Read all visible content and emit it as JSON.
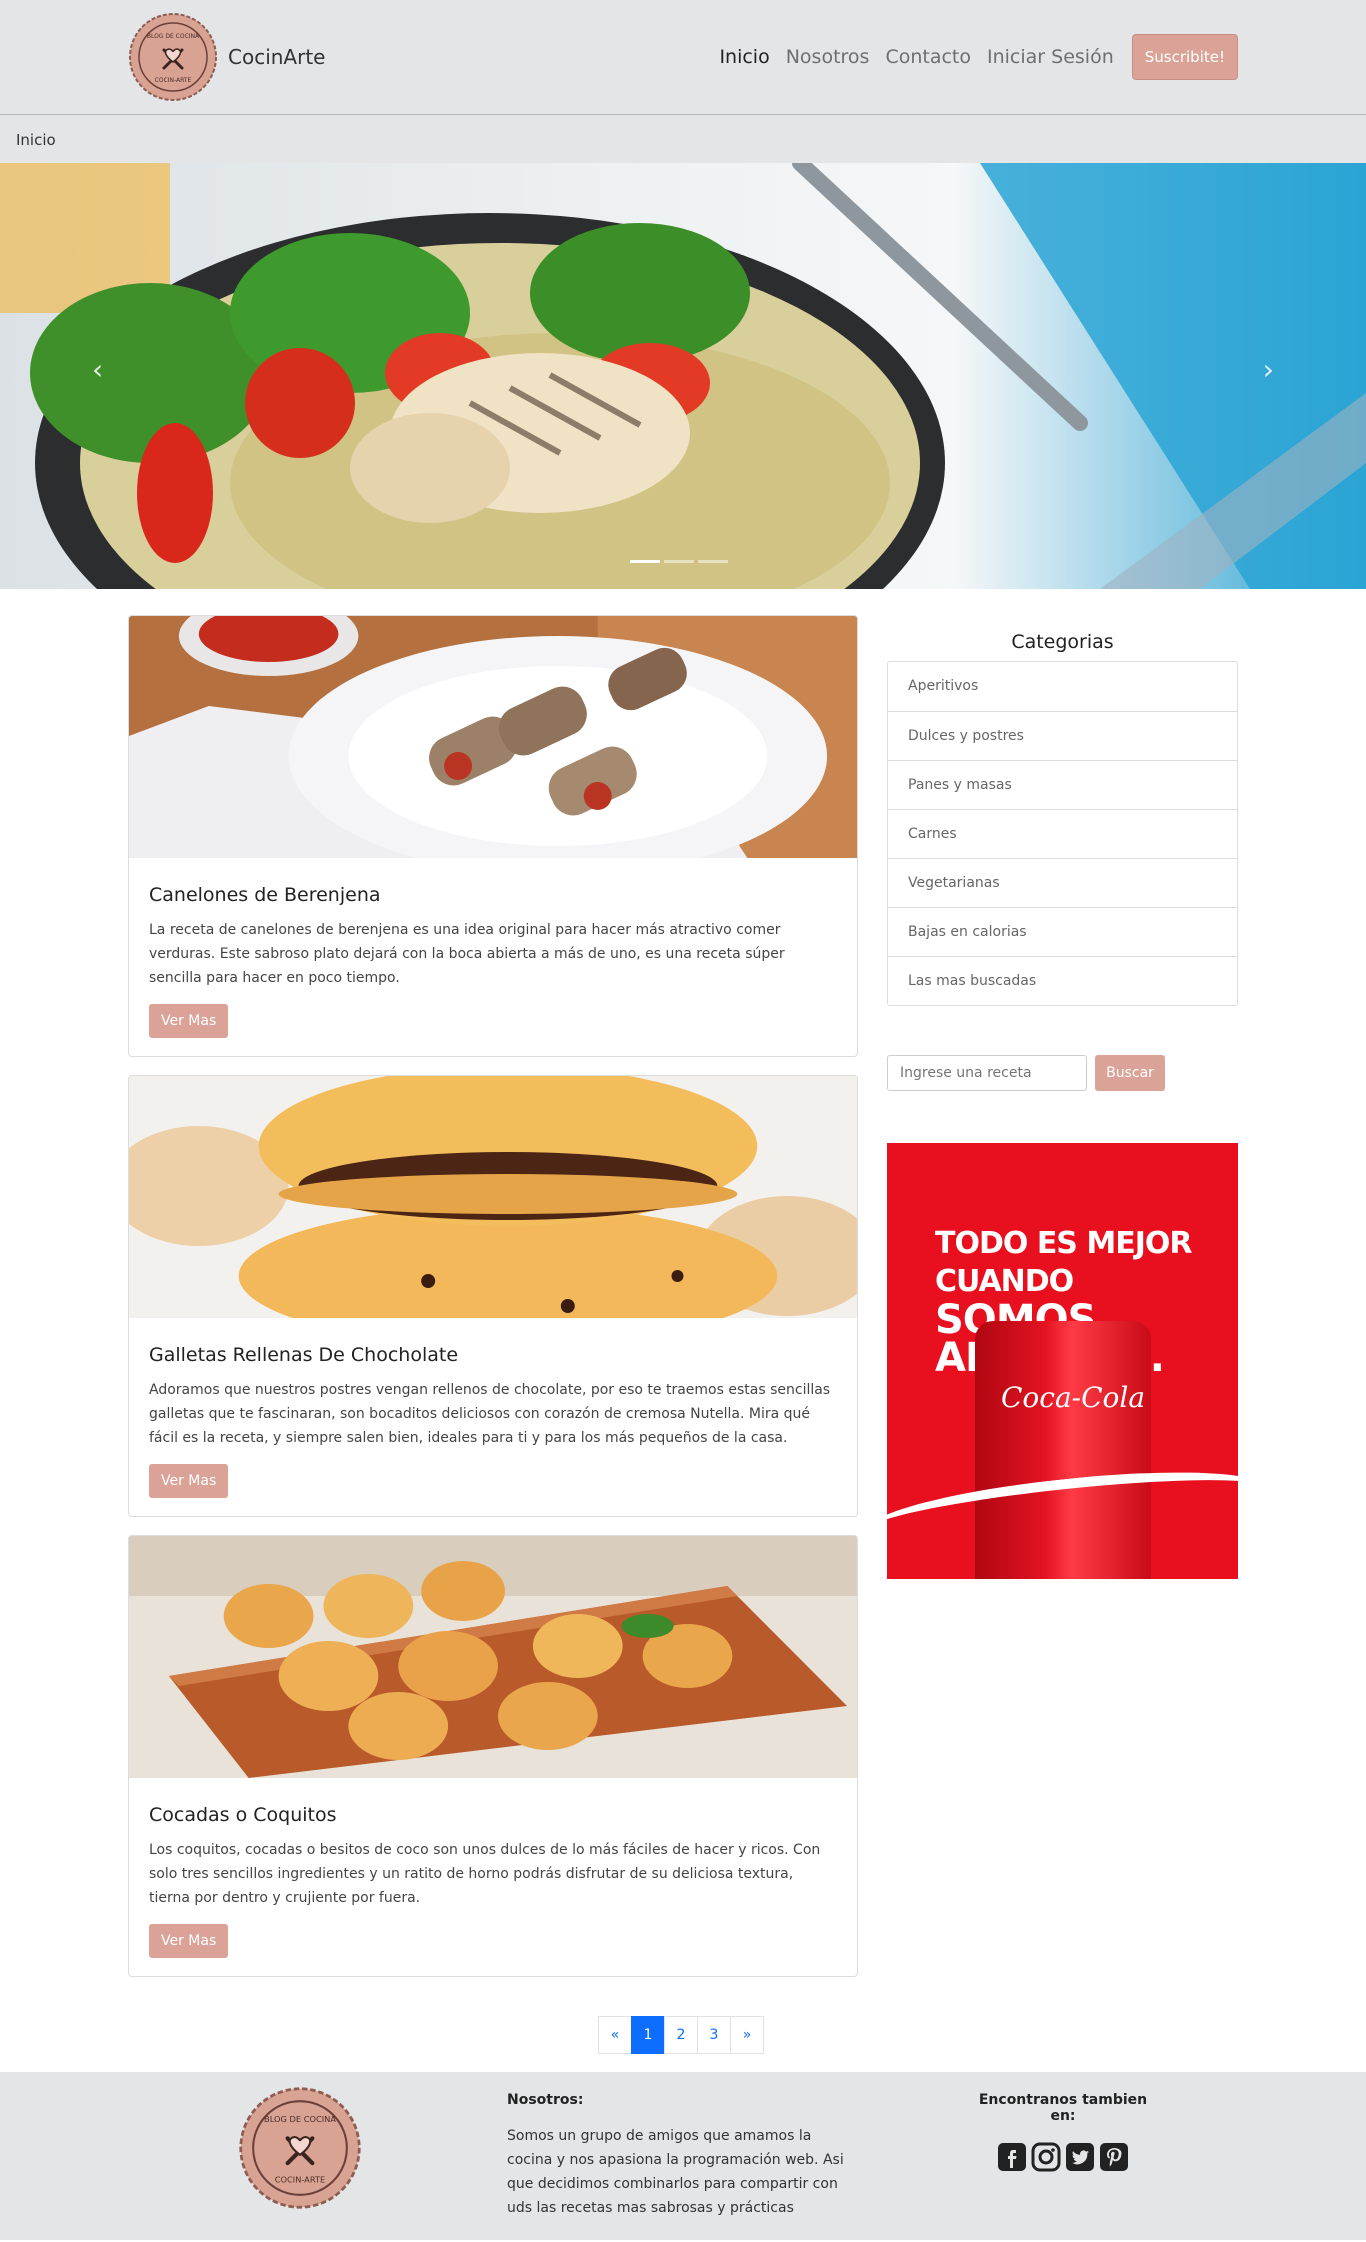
{
  "brand": {
    "name": "CocinArte",
    "logo_text_top": "BLOG DE COCINA",
    "logo_text_bottom": "COCIN-ARTE"
  },
  "nav": {
    "items": [
      "Inicio",
      "Nosotros",
      "Contacto",
      "Iniciar Sesión"
    ],
    "subscribe": "Suscribite!"
  },
  "breadcrumb": "Inicio",
  "hero": {
    "prev": "‹",
    "next": "›"
  },
  "posts": [
    {
      "title": "Canelones de Berenjena",
      "text": "La receta de canelones de berenjena es una idea original para hacer más atractivo comer verduras. Este sabroso plato dejará con la boca abierta a más de uno, es una receta súper sencilla para hacer en poco tiempo.",
      "button": "Ver Mas"
    },
    {
      "title": "Galletas Rellenas De Chocholate",
      "text": "Adoramos que nuestros postres vengan rellenos de chocolate, por eso te traemos estas sencillas galletas que te fascinaran, son bocaditos deliciosos con corazón de cremosa Nutella. Mira qué fácil es la receta, y siempre salen bien, ideales para ti y para los más pequeños de la casa.",
      "button": "Ver Mas"
    },
    {
      "title": "Cocadas o Coquitos",
      "text": "Los coquitos, cocadas o besitos de coco son unos dulces de lo más fáciles de hacer y ricos. Con solo tres sencillos ingredientes y un ratito de horno podrás disfrutar de su deliciosa textura, tierna por dentro y crujiente por fuera.",
      "button": "Ver Mas"
    }
  ],
  "sidebar": {
    "title": "Categorias",
    "categories": [
      "Aperitivos",
      "Dulces y postres",
      "Panes y masas",
      "Carnes",
      "Vegetarianas",
      "Bajas en calorias",
      "Las mas buscadas"
    ],
    "search_placeholder": "Ingrese una receta",
    "search_button": "Buscar",
    "ad": {
      "line1": "TODO ES MEJOR CUANDO",
      "line2": "SOMOS ABIERTOS.",
      "brand": "Coca-Cola"
    }
  },
  "pagination": {
    "prev": "«",
    "pages": [
      "1",
      "2",
      "3"
    ],
    "next": "»"
  },
  "footer": {
    "about_title": "Nosotros:",
    "about_text": "Somos un grupo de amigos que amamos la cocina y nos apasiona la programación web. Asi que decidimos combinarlos para compartir con uds las recetas mas sabrosas y prácticas",
    "social_title": "Encontranos tambien en:",
    "social_icons": [
      "facebook-icon",
      "instagram-icon",
      "twitter-icon",
      "pinterest-icon"
    ]
  },
  "colors": {
    "accent": "#dba397",
    "header_bg": "#e4e5e7",
    "page_active": "#0d6efd"
  }
}
